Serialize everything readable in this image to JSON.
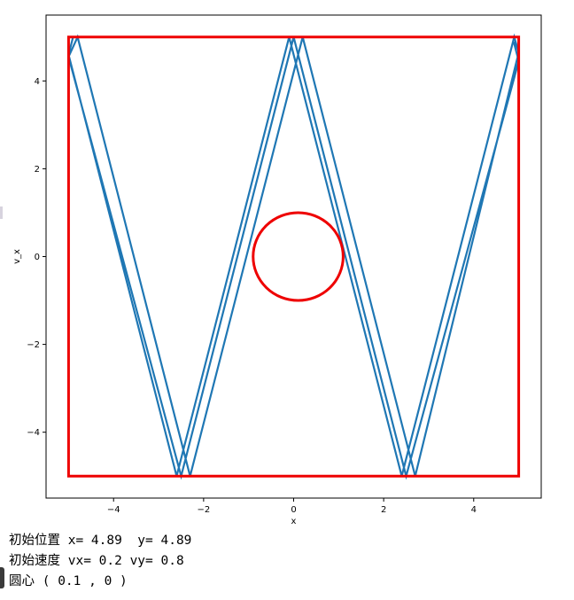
{
  "chart_data": {
    "type": "line",
    "title": "",
    "xlabel": "x",
    "ylabel": "v_x",
    "xlim": [
      -5.5,
      5.5
    ],
    "ylim": [
      -5.5,
      5.5
    ],
    "xticks": [
      -4,
      -2,
      0,
      2,
      4
    ],
    "yticks": [
      -4,
      -2,
      0,
      2,
      4
    ],
    "xtick_labels": [
      "−4",
      "−2",
      "0",
      "2",
      "4"
    ],
    "ytick_labels": [
      "−4",
      "−2",
      "0",
      "2",
      "4"
    ],
    "grid": false,
    "colors": {
      "trajectory": "#1f77b4",
      "boundary": "#ee0000",
      "circle": "#ee0000",
      "axes": "#000000"
    },
    "series": [
      {
        "x": [
          4.89,
          5.0,
          2.5,
          0.0,
          -2.5,
          -5.0,
          -4.8,
          -2.3,
          0.2,
          2.7,
          5.0,
          4.9,
          2.4,
          -0.1,
          -2.6,
          -5.0,
          -4.9
        ],
        "y": [
          4.89,
          4.45,
          -5.0,
          5.0,
          -5.0,
          4.55,
          5.0,
          -5.0,
          5.0,
          -5.0,
          4.65,
          5.0,
          -5.0,
          5.0,
          -5.0,
          4.6,
          5.0
        ]
      }
    ],
    "boundary": {
      "xmin": -5,
      "xmax": 5,
      "ymin": -5,
      "ymax": 5
    },
    "circle": {
      "cx": 0.1,
      "cy": 0,
      "r": 1
    }
  },
  "info": {
    "line1": "初始位置 x= 4.89  y= 4.89",
    "line2": "初始速度 vx= 0.2 vy= 0.8",
    "line3": "圆心 ( 0.1 , 0 )"
  }
}
